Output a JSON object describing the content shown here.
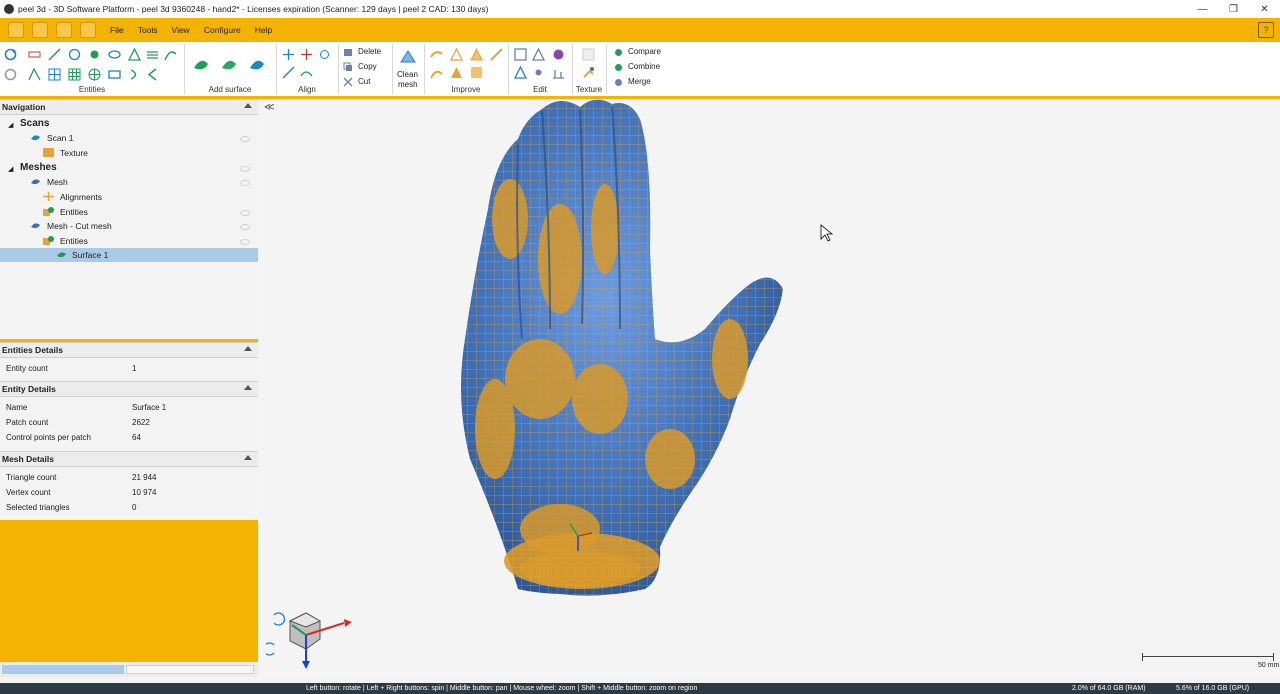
{
  "window": {
    "title": "peel 3d - 3D Software Platform - peel 3d 9360248 - hand2* - Licenses expiration (Scanner: 129 days | peel 2 CAD: 130 days)",
    "minimize": "—",
    "maximize": "❐",
    "close": "✕"
  },
  "menu": {
    "items": [
      "File",
      "Tools",
      "View",
      "Configure",
      "Help"
    ]
  },
  "ribbon": {
    "groups": {
      "entities": "Entities",
      "add_surface": "Add surface",
      "align": "Align",
      "clean_mesh_line1": "Clean",
      "clean_mesh_line2": "mesh",
      "improve": "Improve",
      "edit": "Edit",
      "texture": "Texture"
    },
    "actions": {
      "delete": "Delete",
      "copy": "Copy",
      "cut": "Cut",
      "compare": "Compare",
      "combine": "Combine",
      "merge": "Merge"
    }
  },
  "navigation": {
    "title": "Navigation",
    "scans_header": "Scans",
    "scan1": "Scan 1",
    "texture": "Texture",
    "meshes_header": "Meshes",
    "mesh": "Mesh",
    "alignments": "Alignments",
    "entities1": "Entities",
    "mesh_cut": "Mesh - Cut mesh",
    "entities2": "Entities",
    "surface1": "Surface 1"
  },
  "entities_details": {
    "title": "Entities Details",
    "entity_count_label": "Entity count",
    "entity_count_value": "1"
  },
  "entity_details": {
    "title": "Entity Details",
    "name_label": "Name",
    "name_value": "Surface 1",
    "patch_count_label": "Patch count",
    "patch_count_value": "2622",
    "cpp_label": "Control points per patch",
    "cpp_value": "64"
  },
  "mesh_details": {
    "title": "Mesh Details",
    "triangle_count_label": "Triangle count",
    "triangle_count_value": "21 944",
    "vertex_count_label": "Vertex count",
    "vertex_count_value": "10 974",
    "selected_triangles_label": "Selected triangles",
    "selected_triangles_value": "0"
  },
  "viewport": {
    "scale_label": "50 mm",
    "collapse_glyph": "≪"
  },
  "status": {
    "hints": "Left button: rotate  |  Left + Right buttons: spin  |  Middle button: pan  |  Mouse wheel: zoom  |  Shift + Middle button: zoom on region",
    "ram": "2.0% of 64.0 GB (RAM)",
    "gpu": "5.6% of 16.0 GB (GPU)"
  },
  "colors": {
    "accent": "#f5b301",
    "mesh_blue": "#3f6fb5",
    "mesh_gold": "#d99a2b",
    "selected_row": "#a9cbe8"
  }
}
